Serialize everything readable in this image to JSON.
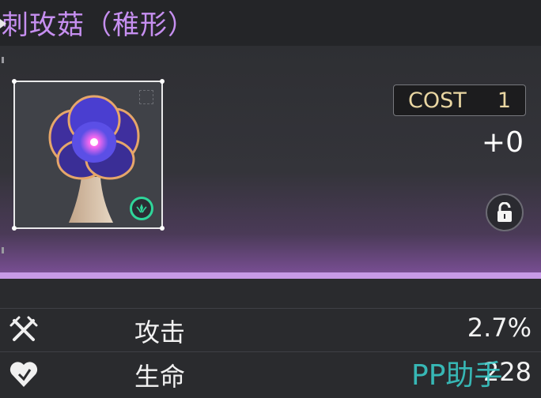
{
  "header": {
    "title": "刺玫菇（稚形）"
  },
  "card": {
    "cost_label": "COST",
    "cost_value": "1",
    "bonus": "+0",
    "badge_icon": "element-badge-icon",
    "lock_icon": "unlock-icon"
  },
  "stats": [
    {
      "icon": "attack-icon",
      "label": "攻击",
      "value": "2.7%"
    },
    {
      "icon": "health-icon",
      "label": "生命",
      "value": "228"
    }
  ],
  "watermark": "PP助手",
  "colors": {
    "title": "#c68ff0",
    "accent_glow": "#c79ae6",
    "badge": "#2fd69a",
    "cost_text": "#e9d6a2"
  }
}
